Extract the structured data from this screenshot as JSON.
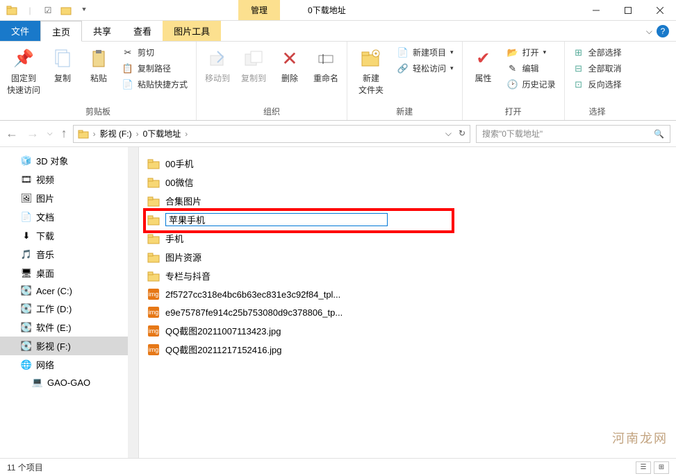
{
  "titlebar": {
    "context_tab": "管理",
    "title": "0下载地址"
  },
  "tabs": {
    "file": "文件",
    "home": "主页",
    "share": "共享",
    "view": "查看",
    "tools": "图片工具"
  },
  "ribbon": {
    "clipboard": {
      "label": "剪贴板",
      "pin": "固定到\n快速访问",
      "copy": "复制",
      "paste": "粘贴",
      "cut": "剪切",
      "copy_path": "复制路径",
      "paste_shortcut": "粘贴快捷方式"
    },
    "organize": {
      "label": "组织",
      "move_to": "移动到",
      "copy_to": "复制到",
      "delete": "删除",
      "rename": "重命名"
    },
    "new": {
      "label": "新建",
      "new_folder": "新建\n文件夹",
      "new_item": "新建项目",
      "easy_access": "轻松访问"
    },
    "open": {
      "label": "打开",
      "properties": "属性",
      "open": "打开",
      "edit": "编辑",
      "history": "历史记录"
    },
    "select": {
      "label": "选择",
      "select_all": "全部选择",
      "select_none": "全部取消",
      "invert": "反向选择"
    }
  },
  "address": {
    "drive": "影视 (F:)",
    "folder": "0下载地址"
  },
  "search": {
    "placeholder": "搜索\"0下载地址\""
  },
  "sidebar": {
    "items": [
      {
        "label": "3D 对象",
        "icon": "3d"
      },
      {
        "label": "视频",
        "icon": "video"
      },
      {
        "label": "图片",
        "icon": "pictures"
      },
      {
        "label": "文档",
        "icon": "docs"
      },
      {
        "label": "下载",
        "icon": "downloads"
      },
      {
        "label": "音乐",
        "icon": "music"
      },
      {
        "label": "桌面",
        "icon": "desktop"
      },
      {
        "label": "Acer (C:)",
        "icon": "drive-c"
      },
      {
        "label": "工作 (D:)",
        "icon": "drive"
      },
      {
        "label": "软件 (E:)",
        "icon": "drive"
      },
      {
        "label": "影视 (F:)",
        "icon": "drive",
        "selected": true
      },
      {
        "label": "网络",
        "icon": "network"
      },
      {
        "label": "GAO-GAO",
        "icon": "pc",
        "sub": true
      }
    ]
  },
  "files": [
    {
      "name": "00手机",
      "type": "folder"
    },
    {
      "name": "00微信",
      "type": "folder"
    },
    {
      "name": "合集图片",
      "type": "folder"
    },
    {
      "name": "苹果手机",
      "type": "folder",
      "editing": true
    },
    {
      "name": "手机",
      "type": "folder"
    },
    {
      "name": "图片资源",
      "type": "folder"
    },
    {
      "name": "专栏与抖音",
      "type": "folder"
    },
    {
      "name": "2f5727cc318e4bc6b63ec831e3c92f84_tpl...",
      "type": "image"
    },
    {
      "name": "e9e75787fe914c25b753080d9c378806_tp...",
      "type": "image"
    },
    {
      "name": "QQ截图20211007113423.jpg",
      "type": "image"
    },
    {
      "name": "QQ截图20211217152416.jpg",
      "type": "image"
    }
  ],
  "status": {
    "count": "11 个项目"
  },
  "watermark": "河南龙网"
}
